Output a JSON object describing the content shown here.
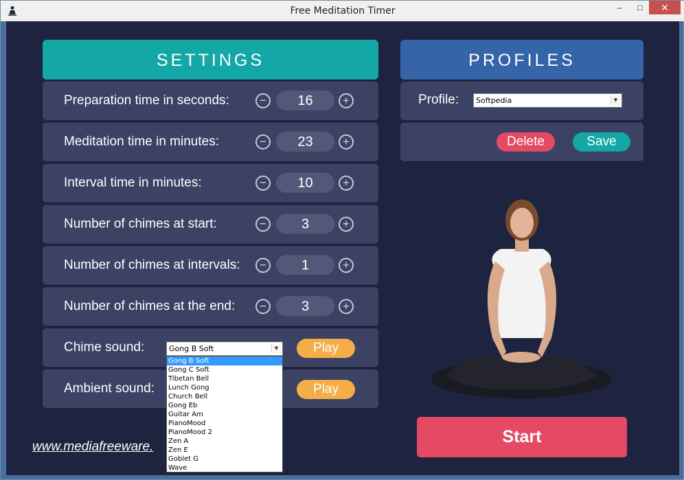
{
  "window": {
    "title": "Free Meditation Timer",
    "minimize": "–",
    "maximize": "□",
    "close": "✕"
  },
  "settings": {
    "header": "SETTINGS",
    "rows": [
      {
        "label": "Preparation time in seconds:",
        "value": "16"
      },
      {
        "label": "Meditation time in minutes:",
        "value": "23"
      },
      {
        "label": "Interval time in minutes:",
        "value": "10"
      },
      {
        "label": "Number of chimes at start:",
        "value": "3"
      },
      {
        "label": "Number of chimes at intervals:",
        "value": "1"
      },
      {
        "label": "Number of chimes at the end:",
        "value": "3"
      }
    ],
    "minus": "−",
    "plus": "+",
    "chime_sound": {
      "label": "Chime sound:",
      "selected": "Gong B Soft",
      "play": "Play"
    },
    "ambient_sound": {
      "label": "Ambient sound:",
      "play": "Play"
    },
    "dropdown_options": [
      "Gong B Soft",
      "Gong C Soft",
      "Tibetan Bell",
      "Lunch Gong",
      "Church Bell",
      "Gong Eb",
      "Guitar Am",
      "PianoMood",
      "PianoMood 2",
      "Zen A",
      "Zen E",
      "Goblet G",
      "Wave"
    ]
  },
  "profiles": {
    "header": "PROFILES",
    "label": "Profile:",
    "selected": "Softpedia",
    "delete": "Delete",
    "save": "Save"
  },
  "start": "Start",
  "website": "www.mediafreeware.",
  "colors": {
    "background": "#1e2440",
    "settings_header": "#13a8a6",
    "profiles_header": "#3564a9",
    "row": "#3b4263",
    "play": "#f5ad47",
    "delete": "#e54a65",
    "save": "#13a8a6",
    "start": "#e54a65"
  }
}
